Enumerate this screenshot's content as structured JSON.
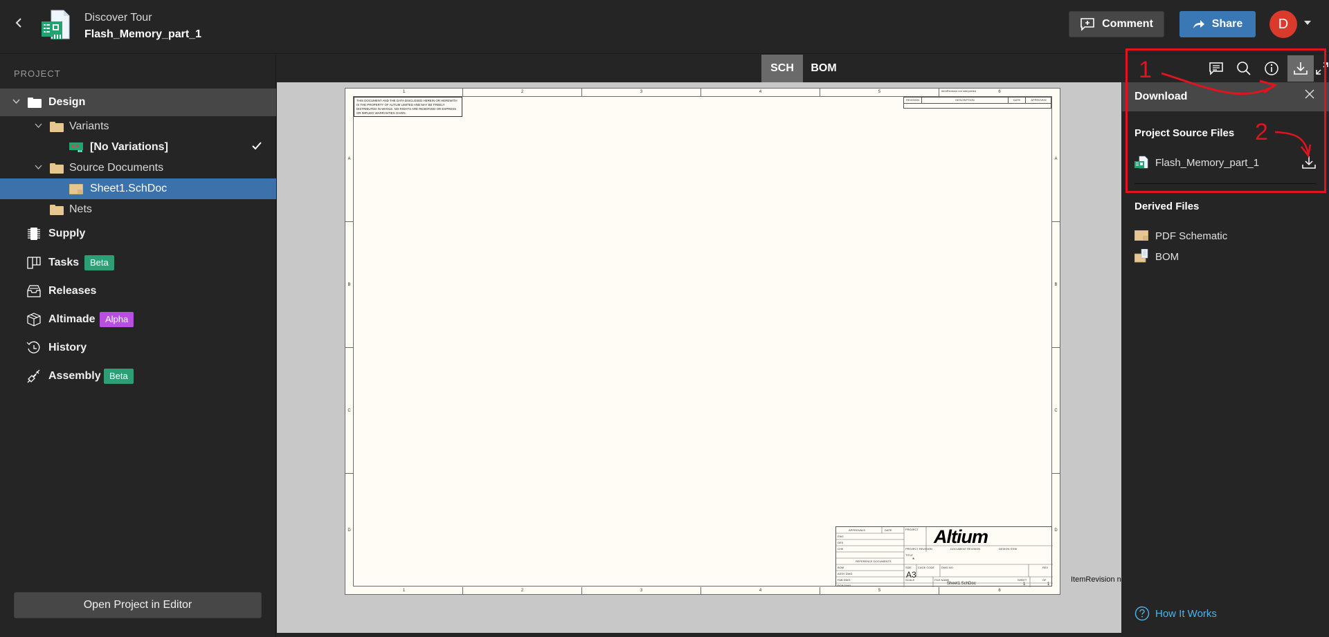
{
  "header": {
    "workspace": "Discover Tour",
    "project_name": "Flash_Memory_part_1",
    "comment_label": "Comment",
    "share_label": "Share",
    "avatar_initial": "D"
  },
  "sidebar": {
    "section_label": "PROJECT",
    "tree": {
      "design": "Design",
      "variants": "Variants",
      "no_variations": "[No Variations]",
      "source_documents": "Source Documents",
      "sheet": "Sheet1.SchDoc",
      "nets": "Nets"
    },
    "nav": [
      {
        "label": "Supply",
        "icon": "chip-icon"
      },
      {
        "label": "Tasks",
        "icon": "kanban-icon",
        "badge": "Beta",
        "badge_color": "#2e9e75"
      },
      {
        "label": "Releases",
        "icon": "inbox-icon"
      },
      {
        "label": "Altimade",
        "icon": "box-icon",
        "badge": "Alpha",
        "badge_color": "#b84fe0"
      },
      {
        "label": "History",
        "icon": "history-icon"
      },
      {
        "label": "Assembly",
        "icon": "assembly-icon",
        "badge": "Beta",
        "badge_color": "#2e9e75"
      }
    ],
    "open_editor_label": "Open Project in Editor"
  },
  "viewer": {
    "tabs": [
      "SCH",
      "BOM"
    ],
    "active_tab": "SCH",
    "sheet": {
      "zones_h": [
        "1",
        "2",
        "3",
        "4",
        "5",
        "6"
      ],
      "zones_v": [
        "A",
        "B",
        "C",
        "D"
      ],
      "notice": "THIS DOCUMENT AND THE DATA DISCLOSED HEREIN OR HEREWITH IS THE PROPERTY OF ALTIUM LIMITED AND MAY BE FREELY DISTRIBUTED IN WHOLE. NO RIGHTS ARE RESERVED OR EXPRESS OR IMPLIED WARRANTIES GIVEN.",
      "rev_headers": [
        "REVISION",
        "DESCRIPTION",
        "DATE",
        "APPROVED"
      ],
      "top_note": "ItemRevision not interpreted",
      "logo": "Altium",
      "size": "A3",
      "filename": "Sheet1.SchDoc",
      "title_value": "*",
      "item_revision_note": "ItemRevision not interpreted",
      "sheet_num": "1",
      "sheet_of": "1",
      "labels": {
        "approvals": "APPROVALS",
        "date": "DATE",
        "project": "PROJECT",
        "eng": "ENG",
        "des": "DES",
        "chk": "CHK",
        "project_revision": "PROJECT REVISION",
        "document_revision": "DOCUMENT REVISION",
        "design_item": "DESIGN ITEM",
        "title": "TITLE",
        "reference_documents": "REFERENCE DOCUMENTS",
        "bom": "BOM",
        "assy_dwg": "ASSY DWG",
        "fab_dwg": "FAB DWG",
        "pcb_dwg": "PCB DWG",
        "size": "SIZE",
        "cage_code": "CAGE CODE",
        "dwg_no": "DWG NO.",
        "rev": "REV",
        "scale": "SCALE",
        "file_name": "FILE NAME",
        "sheet": "SHEET",
        "of": "OF"
      }
    }
  },
  "right_panel": {
    "tools": [
      "comments-icon",
      "search-icon",
      "info-icon",
      "download-icon",
      "fullscreen-icon"
    ],
    "active_tool": "download-icon",
    "download_title": "Download",
    "source_section": "Project Source Files",
    "source_file": "Flash_Memory_part_1",
    "derived_section": "Derived Files",
    "derived_files": [
      "PDF Schematic",
      "BOM"
    ],
    "help_link": "How It Works"
  },
  "annotations": {
    "step1": "1",
    "step2": "2",
    "color": "#e0141e"
  }
}
